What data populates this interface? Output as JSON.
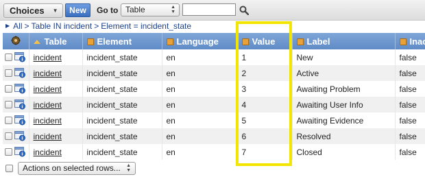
{
  "header": {
    "choices_label": "Choices",
    "new_label": "New",
    "goto_label": "Go to",
    "goto_selected": "Table",
    "search_value": ""
  },
  "breadcrumb": {
    "items": [
      "All",
      "Table IN incident",
      "Element = incident_state"
    ],
    "separator": ">"
  },
  "table": {
    "columns": [
      "Table",
      "Element",
      "Language",
      "Value",
      "Label",
      "Inac"
    ],
    "rows": [
      {
        "table": "incident",
        "element": "incident_state",
        "language": "en",
        "value": "1",
        "label": "New",
        "inactive": "false"
      },
      {
        "table": "incident",
        "element": "incident_state",
        "language": "en",
        "value": "2",
        "label": "Active",
        "inactive": "false"
      },
      {
        "table": "incident",
        "element": "incident_state",
        "language": "en",
        "value": "3",
        "label": "Awaiting Problem",
        "inactive": "false"
      },
      {
        "table": "incident",
        "element": "incident_state",
        "language": "en",
        "value": "4",
        "label": "Awaiting User Info",
        "inactive": "false"
      },
      {
        "table": "incident",
        "element": "incident_state",
        "language": "en",
        "value": "5",
        "label": "Awaiting Evidence",
        "inactive": "false"
      },
      {
        "table": "incident",
        "element": "incident_state",
        "language": "en",
        "value": "6",
        "label": "Resolved",
        "inactive": "false"
      },
      {
        "table": "incident",
        "element": "incident_state",
        "language": "en",
        "value": "7",
        "label": "Closed",
        "inactive": "false"
      }
    ]
  },
  "footer": {
    "actions_label": "Actions on selected rows..."
  },
  "colors": {
    "header_accent": "#5f8bc6",
    "new_button": "#3a6fbf",
    "highlight": "#f2e600"
  }
}
